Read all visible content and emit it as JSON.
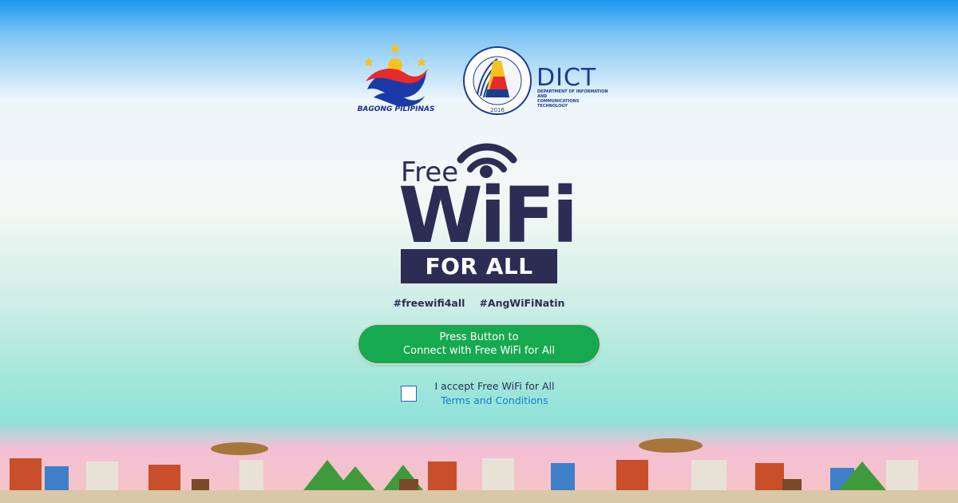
{
  "logos": {
    "bagong_pilipinas": "BAGONG PILIPINAS",
    "dict": {
      "acronym": "DICT",
      "subtitle_line1": "DEPARTMENT OF INFORMATION AND",
      "subtitle_line2": "COMMUNICATIONS TECHNOLOGY",
      "seal_year": "2016",
      "seal_binary_top": "01001001 01000011",
      "seal_binary_left": "01010100",
      "seal_binary_right": "01010100"
    }
  },
  "brand": {
    "free": "Free",
    "wifi": "WiFi",
    "for_all": "FOR ALL"
  },
  "hashtags": [
    "#freewifi4all",
    "#AngWiFiNatin"
  ],
  "connect_button": {
    "line1": "Press Button to",
    "line2": "Connect with Free WiFi for All"
  },
  "terms": {
    "accept_label": "I accept Free WiFi for All",
    "link_label": "Terms and Conditions",
    "checked": false
  },
  "colors": {
    "navy": "#2b2d55",
    "button_green": "#17a94f",
    "link_blue": "#1a7ad6"
  },
  "icons": [
    "wifi-signal-icon",
    "sun-stars-icon",
    "dict-seal-icon",
    "checkbox-icon"
  ]
}
